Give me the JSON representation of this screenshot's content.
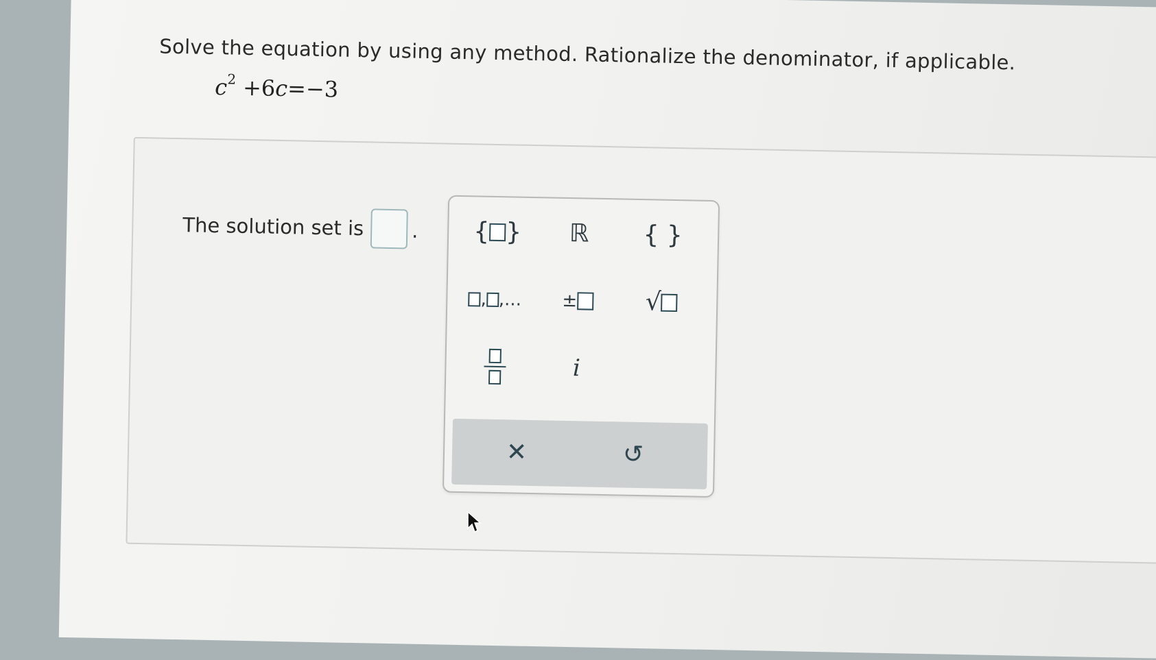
{
  "question": {
    "instruction": "Solve the equation by using any method. Rationalize the denominator, if applicable.",
    "equation": {
      "var1": "c",
      "exp": "2",
      "op1": " +6",
      "var2": "c",
      "rhs": "=−3"
    }
  },
  "answer": {
    "label": "The solution set is",
    "value": "",
    "period": "."
  },
  "palette": {
    "set_braces_left": "{",
    "set_braces_right": "}",
    "reals": "ℝ",
    "empty_set": "{ }",
    "list_dots": "...",
    "plus_minus": "±",
    "sqrt": "√",
    "imaginary": "i",
    "clear": "✕",
    "reset": "↺"
  }
}
